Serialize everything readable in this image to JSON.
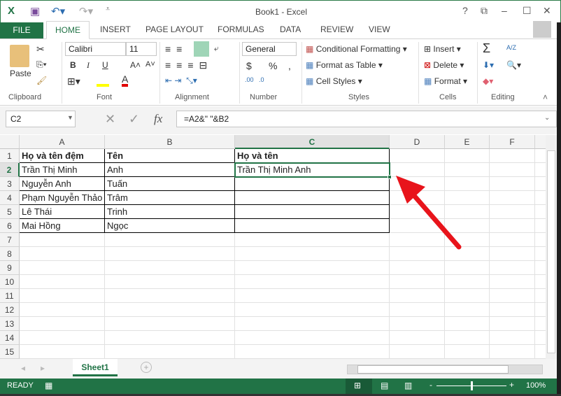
{
  "window": {
    "title": "Book1 - Excel",
    "help": "?",
    "restore_ribbon": "⧉",
    "minimize": "–",
    "maximize": "☐",
    "close": "✕"
  },
  "tabs": {
    "file": "FILE",
    "items": [
      "HOME",
      "INSERT",
      "PAGE LAYOUT",
      "FORMULAS",
      "DATA",
      "REVIEW",
      "VIEW"
    ]
  },
  "ribbon": {
    "clipboard": {
      "label": "Clipboard",
      "paste": "Paste"
    },
    "font": {
      "label": "Font",
      "name": "Calibri",
      "size": "11",
      "bold": "B",
      "italic": "I",
      "underline": "U",
      "grow": "A˄",
      "shrink": "A˅",
      "color_fill": "#ffff00",
      "color_font": "#e00000"
    },
    "alignment": {
      "label": "Alignment"
    },
    "number": {
      "label": "Number",
      "format": "General",
      "currency": "$",
      "percent": "%",
      "comma": ",",
      "inc_dec": ".00",
      "dec_dec": ".0"
    },
    "styles": {
      "label": "Styles",
      "conditional": "Conditional Formatting",
      "format_table": "Format as Table",
      "cell_styles": "Cell Styles"
    },
    "cells": {
      "label": "Cells",
      "insert": "Insert",
      "delete": "Delete",
      "format": "Format"
    },
    "editing": {
      "label": "Editing",
      "sum": "Σ",
      "sort": "A/Z"
    }
  },
  "formula_bar": {
    "name_box": "C2",
    "formula": "=A2&\" \"&B2",
    "fx": "fx"
  },
  "columns": [
    "A",
    "B",
    "C",
    "D",
    "E",
    "F"
  ],
  "rows": [
    "1",
    "2",
    "3",
    "4",
    "5",
    "6",
    "7",
    "8",
    "9",
    "10",
    "11",
    "12",
    "13",
    "14",
    "15"
  ],
  "cells": [
    [
      "Họ và tên đệm",
      "Tên",
      "Họ và tên"
    ],
    [
      "Trần Thị Minh",
      " Anh",
      "Trần Thị Minh  Anh"
    ],
    [
      "Nguyễn Anh",
      " Tuấn",
      ""
    ],
    [
      "Phạm Nguyễn Thảo",
      " Trâm",
      ""
    ],
    [
      "Lê Thái",
      "Trinh",
      ""
    ],
    [
      "Mai Hồng",
      "Ngọc",
      ""
    ]
  ],
  "sheets": [
    "Sheet1"
  ],
  "status": {
    "ready": "READY",
    "zoom": "100%",
    "zoom_level": 100
  },
  "accent": "#217346",
  "annotation_color": "#e8141b"
}
